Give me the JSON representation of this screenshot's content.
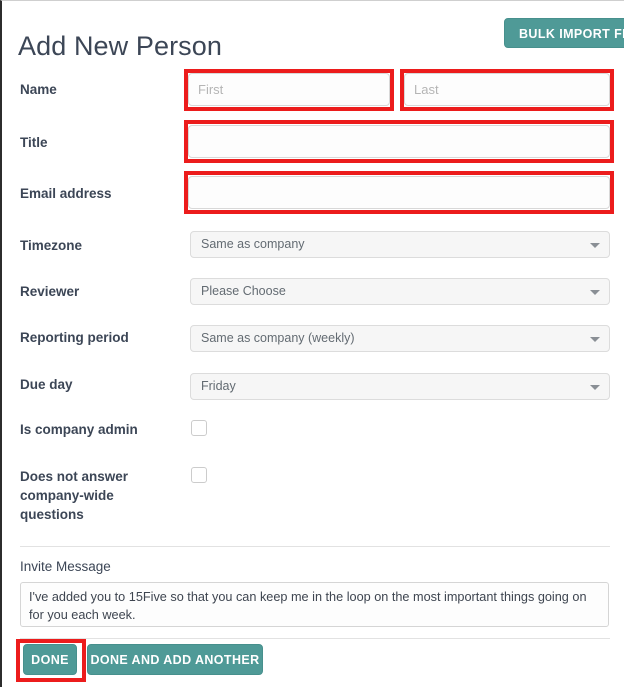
{
  "header": {
    "title": "Add New Person",
    "bulk_import_label": "BULK IMPORT FRO"
  },
  "form": {
    "name": {
      "label": "Name",
      "first_placeholder": "First",
      "first_value": "",
      "last_placeholder": "Last",
      "last_value": ""
    },
    "title": {
      "label": "Title",
      "value": "",
      "placeholder": ""
    },
    "email": {
      "label": "Email address",
      "value": "",
      "placeholder": ""
    },
    "timezone": {
      "label": "Timezone",
      "selected": "Same as company"
    },
    "reviewer": {
      "label": "Reviewer",
      "selected": "Please Choose"
    },
    "reporting_period": {
      "label": "Reporting period",
      "selected": "Same as company (weekly)"
    },
    "due_day": {
      "label": "Due day",
      "selected": "Friday"
    },
    "is_company_admin": {
      "label": "Is company admin",
      "checked": false
    },
    "does_not_answer": {
      "label": "Does not answer company-wide questions",
      "checked": false
    }
  },
  "invite": {
    "label": "Invite Message",
    "message": "I've added you to 15Five so that you can keep me in the loop on the most important things going on for you each week."
  },
  "footer": {
    "done_label": "DONE",
    "done_add_another_label": "DONE AND ADD ANOTHER"
  },
  "annotations": {
    "color": "#ec1c1c",
    "highlighted": [
      "first-name-input",
      "last-name-input",
      "title-input",
      "email-input",
      "done-button"
    ]
  },
  "colors": {
    "accent_teal": "#4f9a97",
    "text_dark": "#3c4656",
    "placeholder_gray": "#b5b5b5",
    "annotation_red": "#ec1c1c"
  },
  "icons": {
    "dropdown": "chevron-down-icon"
  }
}
